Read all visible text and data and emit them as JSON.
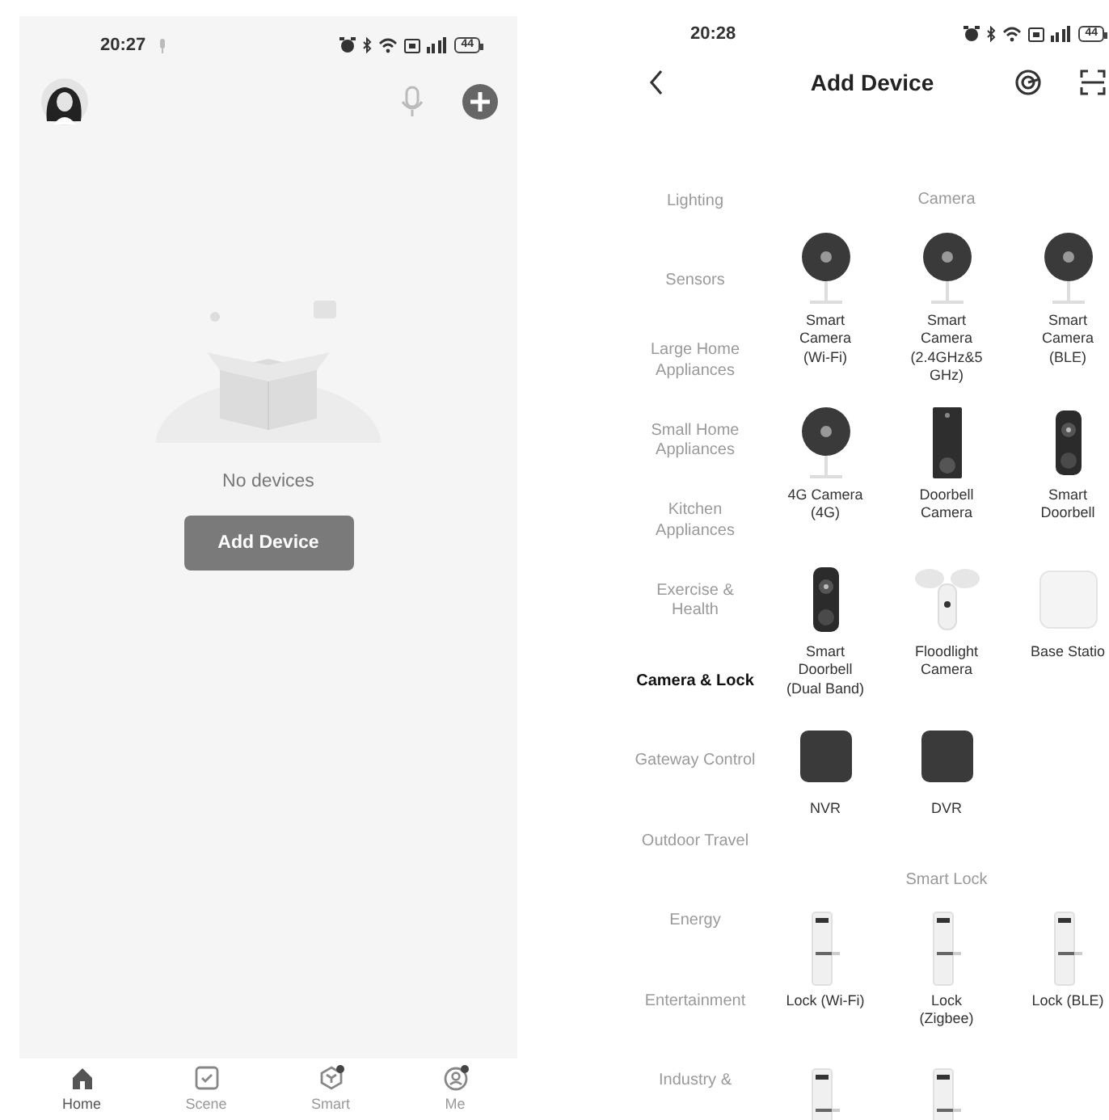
{
  "home_screen": {
    "status_bar": {
      "time": "20:27",
      "battery": "44"
    },
    "empty_state": {
      "message": "No devices",
      "button": "Add Device"
    },
    "tab_bar": [
      {
        "label": "Home",
        "kind": "home",
        "selected": true
      },
      {
        "label": "Scene",
        "kind": "scene",
        "selected": false
      },
      {
        "label": "Smart",
        "kind": "smart",
        "selected": false
      },
      {
        "label": "Me",
        "kind": "me",
        "selected": false
      }
    ]
  },
  "add_device_screen": {
    "status_bar": {
      "time": "20:28",
      "battery": "44"
    },
    "title": "Add Device",
    "categories": [
      {
        "label": "Lighting",
        "selected": false
      },
      {
        "label": "Sensors",
        "selected": false
      },
      {
        "label": "Large Home Appliances",
        "selected": false
      },
      {
        "label": "Small Home Appliances",
        "selected": false
      },
      {
        "label": "Kitchen Appliances",
        "selected": false
      },
      {
        "label": "Exercise & Health",
        "selected": false
      },
      {
        "label": "Camera & Lock",
        "selected": true
      },
      {
        "label": "Gateway Control",
        "selected": false
      },
      {
        "label": "Outdoor Travel",
        "selected": false
      },
      {
        "label": "Energy",
        "selected": false
      },
      {
        "label": "Entertainment",
        "selected": false
      },
      {
        "label": "Industry &",
        "selected": false
      }
    ],
    "sections": [
      {
        "title": "Camera",
        "devices": [
          {
            "name": "Smart Camera (Wi-Fi)",
            "kind": "camera"
          },
          {
            "name": "Smart Camera (2.4GHz&5GHz)",
            "kind": "camera"
          },
          {
            "name": "Smart Camera (BLE)",
            "kind": "camera"
          },
          {
            "name": "4G Camera (4G)",
            "kind": "camera"
          },
          {
            "name": "Doorbell Camera",
            "kind": "doorbell-panel"
          },
          {
            "name": "Smart Doorbell",
            "kind": "doorbell"
          },
          {
            "name": "Smart Doorbell (Dual Band)",
            "kind": "doorbell"
          },
          {
            "name": "Floodlight Camera",
            "kind": "floodlight"
          },
          {
            "name": "Base Statio",
            "kind": "hub"
          },
          {
            "name": "NVR",
            "kind": "recorder"
          },
          {
            "name": "DVR",
            "kind": "recorder"
          }
        ]
      },
      {
        "title": "Smart Lock",
        "devices": [
          {
            "name": "Lock (Wi-Fi)",
            "kind": "lock"
          },
          {
            "name": "Lock (Zigbee)",
            "kind": "lock"
          },
          {
            "name": "Lock (BLE)",
            "kind": "lock"
          },
          {
            "kind": "lock"
          },
          {
            "kind": "lock"
          }
        ]
      }
    ]
  }
}
